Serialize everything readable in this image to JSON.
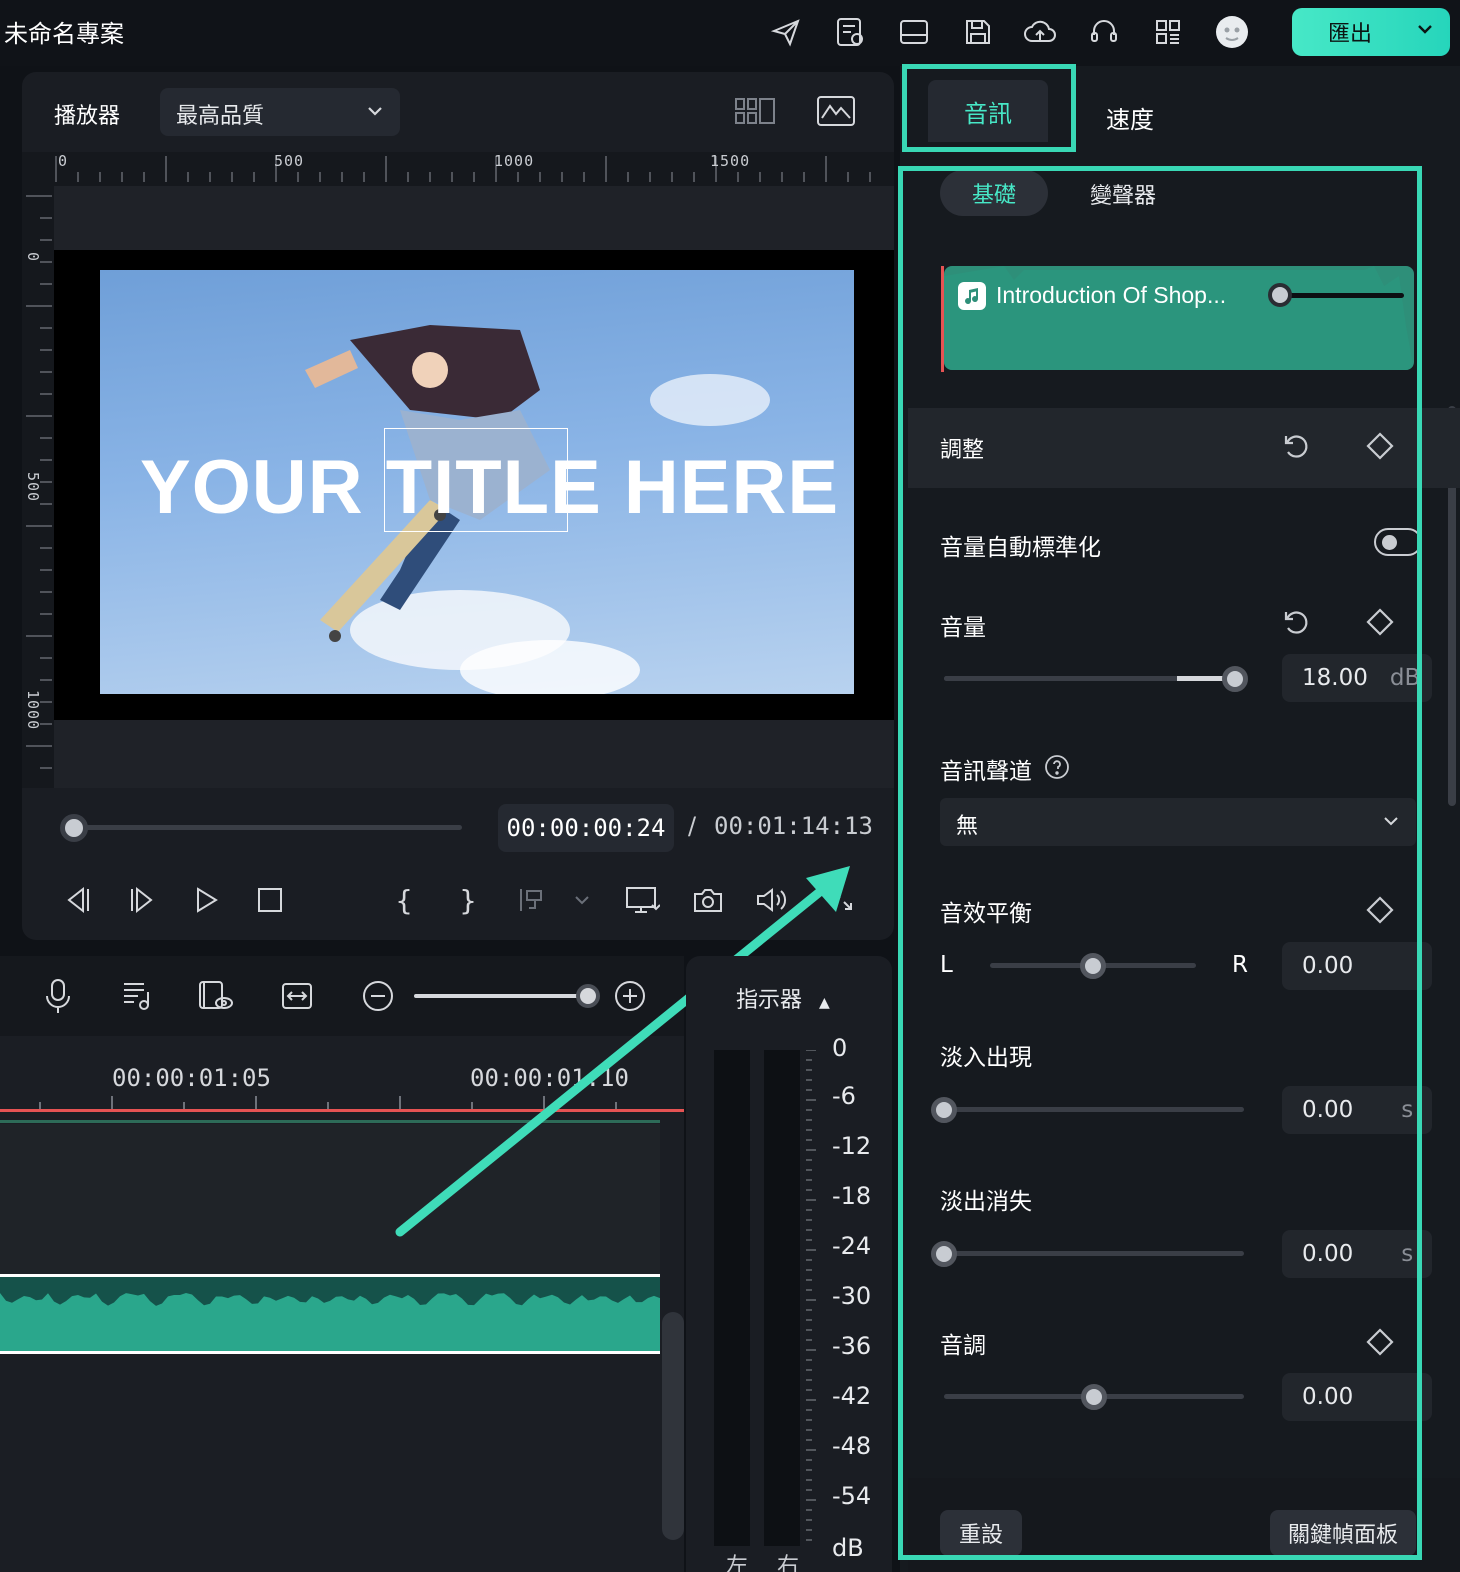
{
  "app": {
    "project_title": "未命名專案",
    "export_label": "匯出"
  },
  "toolbar_icons": [
    "send-icon",
    "task-list-icon",
    "layout-icon",
    "save-icon",
    "cloud-upload-icon",
    "headset-icon",
    "apps-grid-icon",
    "avatar-icon"
  ],
  "player": {
    "label": "播放器",
    "quality": "最高品質",
    "ruler_h": [
      "0",
      "500",
      "1000",
      "1500"
    ],
    "ruler_v": [
      "0",
      "500",
      "1000"
    ],
    "video_title_text": "YOUR TITLE HERE",
    "current_time": "00:00:00:24",
    "time_separator": "/",
    "total_time": "00:01:14:13",
    "scrub_progress": 0.01
  },
  "timeline": {
    "ruler_times": [
      "00:00:01:05",
      "00:00:01:10"
    ],
    "zoom_level": 1.0
  },
  "meter": {
    "label": "指示器",
    "scale": [
      "0",
      "-6",
      "-12",
      "-18",
      "-24",
      "-30",
      "-36",
      "-42",
      "-48",
      "-54"
    ],
    "unit": "dB",
    "left_label": "左",
    "right_label": "右"
  },
  "panel": {
    "tabs": {
      "audio": "音訊",
      "speed": "速度"
    },
    "subtabs": {
      "basic": "基礎",
      "voice_changer": "變聲器"
    },
    "clip_name": "Introduction Of Shop...",
    "adjust_label": "調整",
    "auto_normalize_label": "音量自動標準化",
    "auto_normalize_on": false,
    "volume": {
      "label": "音量",
      "value": "18.00",
      "unit": "dB",
      "fraction": 0.97
    },
    "channel": {
      "label": "音訊聲道",
      "value": "無"
    },
    "balance": {
      "label": "音效平衡",
      "left": "L",
      "right": "R",
      "value": "0.00",
      "fraction": 0.5
    },
    "fade_in": {
      "label": "淡入出現",
      "value": "0.00",
      "unit": "s",
      "fraction": 0.0
    },
    "fade_out": {
      "label": "淡出消失",
      "value": "0.00",
      "unit": "s",
      "fraction": 0.0
    },
    "pitch": {
      "label": "音調",
      "value": "0.00",
      "fraction": 0.5
    },
    "reset_label": "重設",
    "keyframe_label": "關鍵幀面板"
  },
  "colors": {
    "accent": "#47e8c7",
    "highlight": "#39d8b5",
    "playhead": "#e55353",
    "audio_clip": "#2aa78c"
  }
}
